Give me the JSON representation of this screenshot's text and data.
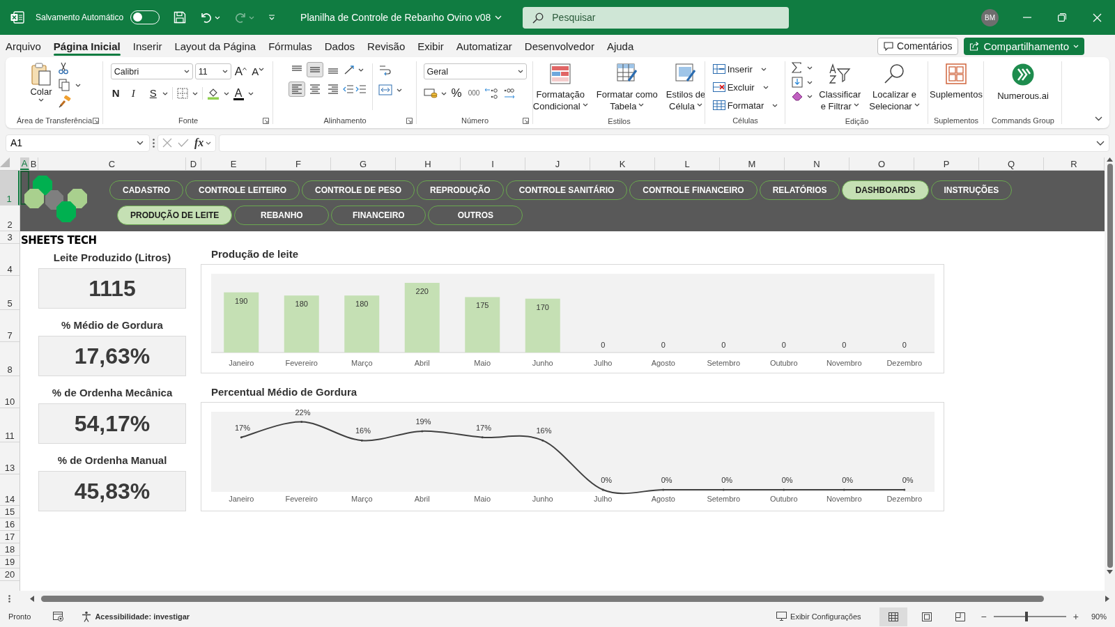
{
  "title_bar": {
    "autosave_label": "Salvamento Automático",
    "autosave_on": false,
    "document_title": "Planilha de Controle de Rebanho Ovino v08",
    "search": {
      "placeholder": "Pesquisar"
    },
    "avatar": "BM"
  },
  "menu_tabs": [
    {
      "label": "Arquivo",
      "selected": false
    },
    {
      "label": "Página Inicial",
      "selected": true
    },
    {
      "label": "Inserir",
      "selected": false
    },
    {
      "label": "Layout da Página",
      "selected": false
    },
    {
      "label": "Fórmulas",
      "selected": false
    },
    {
      "label": "Dados",
      "selected": false
    },
    {
      "label": "Revisão",
      "selected": false
    },
    {
      "label": "Exibir",
      "selected": false
    },
    {
      "label": "Automatizar",
      "selected": false
    },
    {
      "label": "Desenvolvedor",
      "selected": false
    },
    {
      "label": "Ajuda",
      "selected": false
    }
  ],
  "comments_button": "Comentários",
  "share_button": "Compartilhamento",
  "ribbon": [
    {
      "kind": "clipboard",
      "label": "Área de Transferência",
      "paste": "Colar"
    },
    {
      "kind": "font",
      "label": "Fonte",
      "font_name": "Calibri",
      "font_size": "11",
      "grow": "A",
      "shrink": "A",
      "bold": "N",
      "italic": "I",
      "underline": "S",
      "font_color": "A"
    },
    {
      "kind": "alignment",
      "label": "Alinhamento",
      "vertical_align": [
        {
          "selected": false
        },
        {
          "selected": true
        },
        {
          "selected": false
        }
      ],
      "horizontal_align": [
        {
          "selected": true
        },
        {
          "selected": false
        },
        {
          "selected": false
        }
      ]
    },
    {
      "kind": "number",
      "label": "Número",
      "format": "Geral",
      "percent": "%",
      "thousands": "000"
    },
    {
      "kind": "styles",
      "label": "Estilos",
      "buttons": [
        [
          "Formatação",
          "Condicional"
        ],
        [
          "Formatar como",
          "Tabela"
        ],
        [
          "Estilos de",
          "Célula"
        ]
      ]
    },
    {
      "kind": "cells",
      "label": "Células",
      "buttons": [
        "Inserir",
        "Excluir",
        "Formatar"
      ]
    },
    {
      "kind": "editing",
      "label": "Edição",
      "buttons": [
        [
          "Classificar",
          "e Filtrar"
        ],
        [
          "Localizar e",
          "Selecionar"
        ]
      ]
    },
    {
      "kind": "addins",
      "label": "Suplementos",
      "button": "Suplementos"
    },
    {
      "kind": "commands",
      "label": "Commands Group",
      "button": "Numerous.ai"
    }
  ],
  "formula_bar": {
    "name_box": "A1",
    "function_glyph": "fx"
  },
  "columns": [
    {
      "label": "A",
      "selected": true
    },
    {
      "label": "B",
      "selected": false
    },
    {
      "label": "C",
      "selected": false
    },
    {
      "label": "D",
      "selected": false
    },
    {
      "label": "E",
      "selected": false
    },
    {
      "label": "F",
      "selected": false
    },
    {
      "label": "G",
      "selected": false
    },
    {
      "label": "H",
      "selected": false
    },
    {
      "label": "I",
      "selected": false
    },
    {
      "label": "J",
      "selected": false
    },
    {
      "label": "K",
      "selected": false
    },
    {
      "label": "L",
      "selected": false
    },
    {
      "label": "M",
      "selected": false
    },
    {
      "label": "N",
      "selected": false
    },
    {
      "label": "O",
      "selected": false
    },
    {
      "label": "P",
      "selected": false
    },
    {
      "label": "Q",
      "selected": false
    },
    {
      "label": "R",
      "selected": false
    }
  ],
  "rows": [
    {
      "label": "1",
      "selected": true
    },
    {
      "label": "2",
      "selected": false
    },
    {
      "label": "3",
      "selected": false
    },
    {
      "label": "4",
      "selected": false
    },
    {
      "label": "5",
      "selected": false
    },
    {
      "label": "7",
      "selected": false
    },
    {
      "label": "8",
      "selected": false
    },
    {
      "label": "10",
      "selected": false
    },
    {
      "label": "11",
      "selected": false
    },
    {
      "label": "13",
      "selected": false
    },
    {
      "label": "14",
      "selected": false
    },
    {
      "label": "15",
      "selected": false
    },
    {
      "label": "16",
      "selected": false
    },
    {
      "label": "17",
      "selected": false
    },
    {
      "label": "18",
      "selected": false
    },
    {
      "label": "19",
      "selected": false
    },
    {
      "label": "20",
      "selected": false
    }
  ],
  "navigation": {
    "row_1": [
      {
        "label": "CADASTRO",
        "selected": false
      },
      {
        "label": "CONTROLE LEITEIRO",
        "selected": false
      },
      {
        "label": "CONTROLE DE PESO",
        "selected": false
      },
      {
        "label": "REPRODUÇÃO",
        "selected": false
      },
      {
        "label": "CONTROLE SANITÁRIO",
        "selected": false
      },
      {
        "label": "CONTROLE FINANCEIRO",
        "selected": false
      },
      {
        "label": "RELATÓRIOS",
        "selected": false
      },
      {
        "label": "DASHBOARDS",
        "selected": true
      },
      {
        "label": "INSTRUÇÕES",
        "selected": false
      }
    ],
    "row_2": [
      {
        "label": "PRODUÇÃO DE LEITE",
        "selected": true
      },
      {
        "label": "REBANHO",
        "selected": false
      },
      {
        "label": "FINANCEIRO",
        "selected": false
      },
      {
        "label": "OUTROS",
        "selected": false
      }
    ]
  },
  "brand_name": "SHEETS TECH",
  "kpis": [
    {
      "title": "Leite Produzido (Litros)",
      "value": "1115"
    },
    {
      "title": "% Médio de Gordura",
      "value": "17,63%"
    },
    {
      "title": "% de Ordenha Mecânica",
      "value": "54,17%"
    },
    {
      "title": "% de Ordenha Manual",
      "value": "45,83%"
    }
  ],
  "charts": [
    {
      "title": "Produção de leite",
      "chart_data": {
        "type": "bar",
        "categories": [
          "Janeiro",
          "Fevereiro",
          "Março",
          "Abril",
          "Maio",
          "Junho",
          "Julho",
          "Agosto",
          "Setembro",
          "Outubro",
          "Novembro",
          "Dezembro"
        ],
        "series": [
          {
            "color": "#c5e0b4",
            "values": [
              190,
              180,
              180,
              220,
              175,
              170,
              0,
              0,
              0,
              0,
              0,
              0
            ]
          }
        ],
        "data_labels": true
      }
    },
    {
      "title": "Percentual Médio de Gordura",
      "label_suffix": "%",
      "chart_data": {
        "type": "line",
        "categories": [
          "Janeiro",
          "Fevereiro",
          "Março",
          "Abril",
          "Maio",
          "Junho",
          "Julho",
          "Agosto",
          "Setembro",
          "Outubro",
          "Novembro",
          "Dezembro"
        ],
        "series": [
          {
            "color": "#404040",
            "values": [
              17,
              22,
              16,
              19,
              17,
              16,
              0,
              0,
              0,
              0,
              0,
              0
            ]
          }
        ],
        "data_labels": true
      }
    }
  ],
  "status_bar": {
    "status": "Pronto",
    "accessibility": "Acessibilidade: investigar",
    "display_settings": "Exibir Configurações",
    "views": [
      {
        "selected": true
      },
      {
        "selected": false
      },
      {
        "selected": false
      }
    ],
    "zoom": {
      "out": "−",
      "in": "+",
      "level": 0.45,
      "reading": "90%"
    }
  }
}
